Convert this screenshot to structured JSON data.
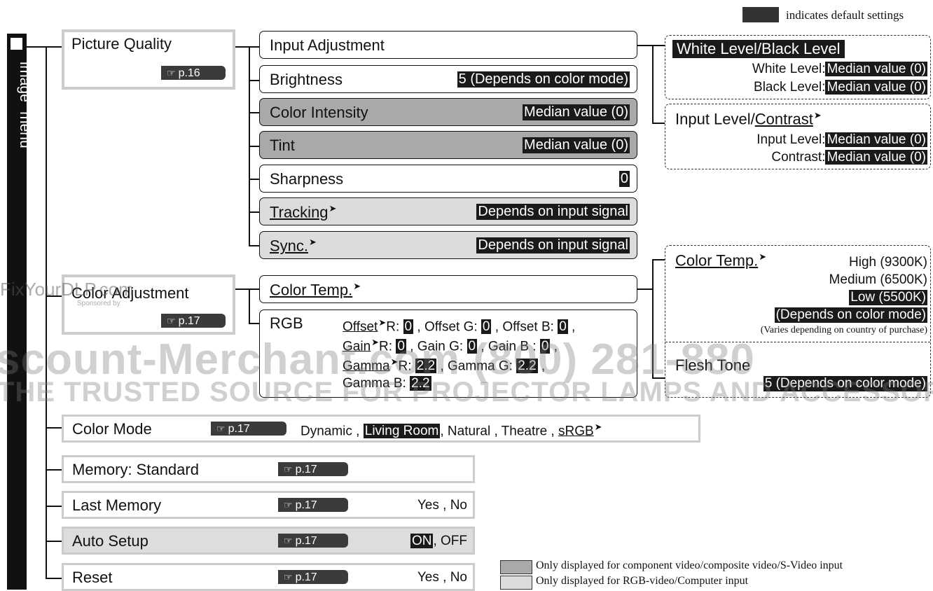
{
  "legend": {
    "default_note": "indicates default settings",
    "component_note": "Only displayed for component video/composite video/S-Video input",
    "rgb_note": "Only displayed for RGB-video/Computer input"
  },
  "menu_tab": {
    "label": "\"Image\" menu"
  },
  "watermark": {
    "site": "FixYourDLP.com",
    "sponsor": "Sponsored by",
    "line1": "scount-Merchant.com (800) 281-880",
    "line2": "THE TRUSTED SOURCE FOR PROJECTOR LAMPS AND ACCESSORIES"
  },
  "picture_quality": {
    "title": "Picture Quality",
    "page": "p.16"
  },
  "color_adjustment": {
    "title": "Color Adjustment",
    "page": "p.17"
  },
  "items": {
    "input_adjustment": {
      "label": "Input Adjustment"
    },
    "brightness": {
      "label": "Brightness",
      "value": "5 (Depends on color mode)"
    },
    "color_intensity": {
      "label": "Color Intensity",
      "value": "Median value (0)"
    },
    "tint": {
      "label": "Tint",
      "value": "Median value (0)"
    },
    "sharpness": {
      "label": "Sharpness",
      "value": "0"
    },
    "tracking": {
      "label": "Tracking",
      "value": "Depends on input signal"
    },
    "sync": {
      "label": "Sync.",
      "value": "Depends on input signal"
    },
    "color_temp": {
      "label": "Color Temp."
    },
    "rgb": {
      "label": "RGB",
      "offset": "Offset",
      "r_label": "R:",
      "offset_r": "0",
      "offset_g_label": ", Offset G:",
      "offset_g": "0",
      "offset_b_label": ", Offset B:",
      "offset_b": "0",
      "gain": "Gain",
      "gain_r": "0",
      "gain_g_label": ", Gain G:",
      "gain_g": "0",
      "gain_b_label": ", Gain B :",
      "gain_b": "0",
      "gamma": "Gamma",
      "gamma_r": "2.2",
      "gamma_g_label": ", Gamma G:",
      "gamma_g": "2.2",
      "gamma_b_label": "Gamma B:",
      "gamma_b": "2.2",
      "comma": ","
    }
  },
  "submenus": {
    "white_black": {
      "title": "White Level/Black Level",
      "white_label": "White Level:",
      "white_value": "Median value (0)",
      "black_label": "Black Level:",
      "black_value": "Median value (0)"
    },
    "input_contrast": {
      "title_a": "Input Level/",
      "title_b": "Contrast",
      "input_label": "Input Level:",
      "input_value": "Median value (0)",
      "contrast_label": "Contrast:",
      "contrast_value": "Median value (0)"
    },
    "color_temp": {
      "title": "Color Temp.",
      "high": "High (9300K)",
      "medium": "Medium (6500K)",
      "low": "Low (5500K)",
      "depends": "(Depends on color mode)",
      "varies": "(Varies depending on country of purchase)"
    },
    "flesh_tone": {
      "title": "Flesh Tone",
      "value": "5 (Depends on color mode)"
    }
  },
  "bottom_rows": {
    "color_mode": {
      "label": "Color Mode",
      "page": "p.17",
      "opt1": "Dynamic ,",
      "opt2": "Living Room",
      "opt3": ", Natural , Theatre ,",
      "opt4": "sRGB"
    },
    "memory": {
      "label": "Memory: Standard",
      "page": "p.17"
    },
    "last_memory": {
      "label": "Last Memory",
      "page": "p.17",
      "value": "Yes , No"
    },
    "auto_setup": {
      "label": "Auto Setup",
      "page": "p.17",
      "value_on": "ON",
      "value_rest": ", OFF"
    },
    "reset": {
      "label": "Reset",
      "page": "p.17",
      "value": "Yes , No"
    }
  }
}
